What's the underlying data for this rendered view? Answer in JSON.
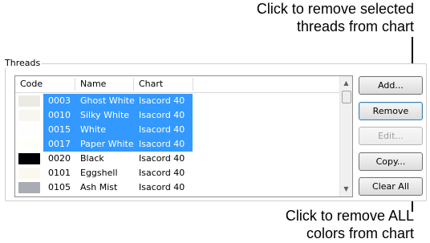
{
  "callouts": {
    "top_line1": "Click to remove selected",
    "top_line2": "threads from chart",
    "bottom_line1": "Click to remove ALL",
    "bottom_line2": "colors from chart"
  },
  "group": {
    "title": "Threads"
  },
  "list": {
    "headers": {
      "code": "Code",
      "name": "Name",
      "chart": "Chart"
    },
    "rows": [
      {
        "code": "0003",
        "name": "Ghost White",
        "chart": "Isacord 40",
        "color": "#ebebe3",
        "selected": true
      },
      {
        "code": "0010",
        "name": "Silky White",
        "chart": "Isacord 40",
        "color": "#f7f7ef",
        "selected": true
      },
      {
        "code": "0015",
        "name": "White",
        "chart": "Isacord 40",
        "color": "#fefefe",
        "selected": true
      },
      {
        "code": "0017",
        "name": "Paper White",
        "chart": "Isacord 40",
        "color": "#fffff8",
        "selected": true
      },
      {
        "code": "0020",
        "name": "Black",
        "chart": "Isacord 40",
        "color": "#000000",
        "selected": false
      },
      {
        "code": "0101",
        "name": "Eggshell",
        "chart": "Isacord 40",
        "color": "#fbf9ef",
        "selected": false
      },
      {
        "code": "0105",
        "name": "Ash Mist",
        "chart": "Isacord 40",
        "color": "#a9adb3",
        "selected": false
      }
    ]
  },
  "buttons": {
    "add": "Add...",
    "remove": "Remove",
    "edit": "Edit...",
    "copy": "Copy...",
    "clear_all": "Clear All"
  },
  "colors": {
    "selection": "#3399ff",
    "accent_border": "#3c7fb1"
  }
}
